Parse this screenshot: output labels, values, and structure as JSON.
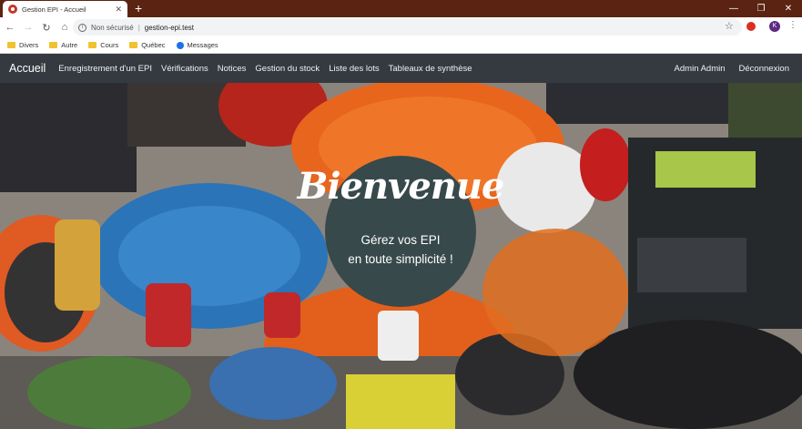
{
  "browser": {
    "tab_title": "Gestion EPI - Accueil",
    "tab_close": "✕",
    "new_tab": "+",
    "security_label": "Non sécurisé",
    "url": "gestion-epi.test",
    "profile_initial": "K"
  },
  "bookmarks": [
    {
      "label": "Divers",
      "icon": "folder-icon"
    },
    {
      "label": "Autre",
      "icon": "folder-icon"
    },
    {
      "label": "Cours",
      "icon": "folder-icon"
    },
    {
      "label": "Québec",
      "icon": "folder-icon"
    },
    {
      "label": "Messages",
      "icon": "messages-icon"
    }
  ],
  "navbar": {
    "brand": "Accueil",
    "links": [
      "Enregistrement d'un EPI",
      "Vérifications",
      "Notices",
      "Gestion du stock",
      "Liste des lots",
      "Tableaux de synthèse"
    ],
    "user": "Admin Admin",
    "logout": "Déconnexion",
    "background": "#343a40"
  },
  "hero": {
    "title": "Bienvenue",
    "tagline_line1": "Gérez vos EPI",
    "tagline_line2": "en toute simplicité !",
    "badge_color": "#38494b"
  }
}
